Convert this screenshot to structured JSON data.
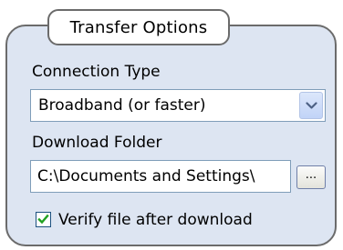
{
  "group": {
    "title": "Transfer Options"
  },
  "connection_type": {
    "label": "Connection Type",
    "selected": "Broadband (or faster)",
    "icon": "chevron-down-icon"
  },
  "download_folder": {
    "label": "Download Folder",
    "value": "C:\\Documents and Settings\\",
    "browse_label": "..."
  },
  "verify": {
    "label": "Verify file after download",
    "checked": true
  },
  "colors": {
    "panel_bg": "#dde5f2",
    "border": "#6b6b6b",
    "check": "#21a121"
  }
}
